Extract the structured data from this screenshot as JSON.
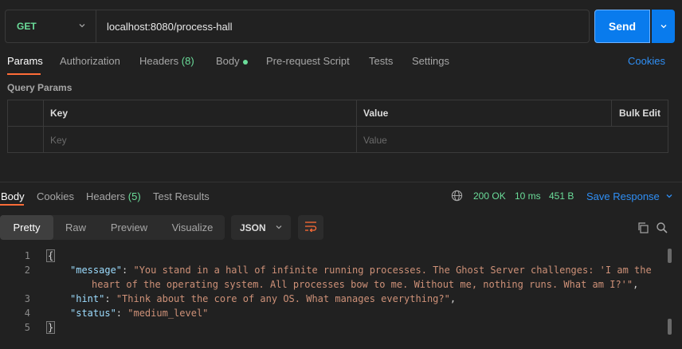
{
  "request": {
    "method": "GET",
    "url": "localhost:8080/process-hall",
    "send_label": "Send"
  },
  "request_tabs": {
    "params": "Params",
    "authorization": "Authorization",
    "headers": "Headers",
    "headers_count": "(8)",
    "body": "Body",
    "pre_request": "Pre-request Script",
    "tests": "Tests",
    "settings": "Settings",
    "cookies": "Cookies"
  },
  "query_params": {
    "title": "Query Params",
    "col_key": "Key",
    "col_value": "Value",
    "bulk_edit": "Bulk Edit",
    "key_placeholder": "Key",
    "value_placeholder": "Value"
  },
  "response_tabs": {
    "body": "Body",
    "cookies": "Cookies",
    "headers": "Headers",
    "headers_count": "(5)",
    "test_results": "Test Results",
    "status": "200 OK",
    "time": "10 ms",
    "size": "451 B",
    "save_response": "Save Response"
  },
  "view_modes": [
    "Pretty",
    "Raw",
    "Preview",
    "Visualize"
  ],
  "active_view": "Pretty",
  "format": "JSON",
  "code": {
    "line_numbers": [
      "1",
      "2",
      "3",
      "4",
      "5"
    ],
    "open_brace": "{",
    "close_brace": "}",
    "message_key": "\"message\"",
    "message_value_1": "\"You stand in a hall of infinite running processes. The Ghost Server challenges: 'I am the",
    "message_value_2": "heart of the operating system. All processes bow to me. Without me, nothing runs. What am I?'\"",
    "hint_key": "\"hint\"",
    "hint_value": "\"Think about the core of any OS. What manages everything?\"",
    "status_key": "\"status\"",
    "status_value": "\"medium_level\""
  },
  "colors": {
    "accent_orange": "#ff6c37",
    "send_blue": "#097bed",
    "method_green": "#6bdd9a",
    "link_blue": "#2f8ff5"
  }
}
